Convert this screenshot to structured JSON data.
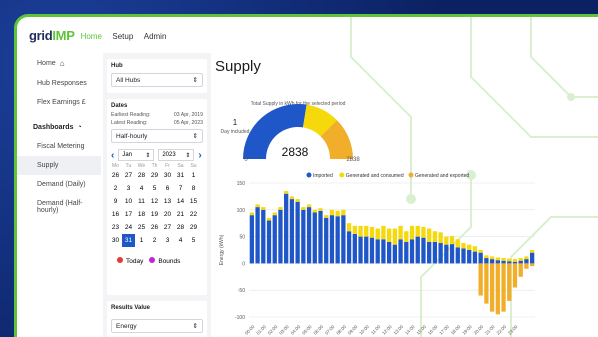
{
  "app": {
    "logo_prefix": "grid",
    "logo_suffix": "IMP",
    "nav": [
      "Home",
      "Setup",
      "Admin"
    ]
  },
  "sidebar": {
    "items": [
      {
        "label": "Home",
        "icon": "home-icon"
      },
      {
        "label": "Hub Responses"
      },
      {
        "label": "Flex Earnings £"
      }
    ],
    "section": {
      "label": "Dashboards",
      "icon": "dashboard-icon"
    },
    "sub_items": [
      "Fiscal Metering",
      "Supply",
      "Demand (Daily)",
      "Demand (Half-hourly)"
    ]
  },
  "filters": {
    "hub_label": "Hub",
    "hub_value": "All Hubs",
    "dates_label": "Dates",
    "earliest_label": "Earliest Reading:",
    "earliest_value": "03 Apr, 2019",
    "latest_label": "Latest Reading:",
    "latest_value": "05 Apr, 2023",
    "interval_value": "Half-hourly",
    "results_label": "Results Value",
    "results_value": "Energy"
  },
  "calendar": {
    "month": "Jan",
    "year": "2023",
    "dow": [
      "Mo",
      "Tu",
      "We",
      "Th",
      "Fr",
      "Sa",
      "Su"
    ],
    "weeks": [
      [
        "26",
        "27",
        "28",
        "29",
        "30",
        "31",
        "1"
      ],
      [
        "2",
        "3",
        "4",
        "5",
        "6",
        "7",
        "8"
      ],
      [
        "9",
        "10",
        "11",
        "12",
        "13",
        "14",
        "15"
      ],
      [
        "16",
        "17",
        "18",
        "19",
        "20",
        "21",
        "22"
      ],
      [
        "23",
        "24",
        "25",
        "26",
        "27",
        "28",
        "29"
      ],
      [
        "30",
        "31",
        "1",
        "2",
        "3",
        "4",
        "5"
      ]
    ],
    "today_label": "Today",
    "bounds_label": "Bounds",
    "today_color": "#e53935",
    "bounds_color": "#c026d3"
  },
  "main": {
    "title": "Supply",
    "gauge_caption": "Total Supply in kWh for the selected period",
    "days_value": "1",
    "days_label": "Day included",
    "gauge_min": "0",
    "gauge_value": "2838",
    "gauge_max": "2838",
    "segments": [
      {
        "name": "Imported",
        "value": 0.55,
        "color": "#1f57c8"
      },
      {
        "name": "Generated and consumed",
        "value": 0.2,
        "color": "#f5d90a"
      },
      {
        "name": "Generated and exported",
        "value": 0.25,
        "color": "#f0ae2a"
      }
    ]
  },
  "chart_data": {
    "type": "bar",
    "ylabel": "Energy (kWh)",
    "ylim": [
      -100,
      150
    ],
    "yticks": [
      150,
      100,
      50,
      0,
      -50,
      -100
    ],
    "xticks": [
      "00:00",
      "01:00",
      "02:00",
      "03:00",
      "04:00",
      "05:00",
      "06:00",
      "07:00",
      "08:00",
      "09:00",
      "10:00",
      "11:00",
      "12:00",
      "13:00",
      "14:00",
      "15:00",
      "16:00",
      "17:00",
      "18:00",
      "19:00",
      "20:00",
      "21:00",
      "22:00",
      "23:00"
    ],
    "legend": [
      "Imported",
      "Generated and consumed",
      "Generated and exported"
    ],
    "series": [
      {
        "name": "Imported",
        "color": "#1f57c8",
        "values": [
          90,
          105,
          100,
          80,
          90,
          100,
          130,
          120,
          115,
          100,
          105,
          95,
          98,
          85,
          90,
          88,
          90,
          60,
          55,
          50,
          50,
          48,
          45,
          45,
          40,
          35,
          45,
          40,
          45,
          50,
          48,
          40,
          40,
          38,
          35,
          36,
          30,
          28,
          25,
          22,
          20,
          10,
          8,
          6,
          5,
          4,
          3,
          5,
          8,
          20
        ]
      },
      {
        "name": "Generated and consumed",
        "color": "#f5d90a",
        "values": [
          5,
          5,
          5,
          5,
          5,
          5,
          5,
          5,
          5,
          5,
          5,
          5,
          5,
          5,
          10,
          10,
          10,
          15,
          15,
          20,
          20,
          20,
          20,
          25,
          25,
          30,
          25,
          20,
          25,
          20,
          20,
          25,
          20,
          20,
          15,
          15,
          15,
          10,
          10,
          10,
          5,
          5,
          5,
          5,
          5,
          5,
          5,
          5,
          5,
          5
        ]
      },
      {
        "name": "Generated and exported",
        "color": "#f0ae2a",
        "values": [
          0,
          0,
          0,
          0,
          0,
          0,
          0,
          0,
          0,
          0,
          0,
          0,
          0,
          0,
          0,
          0,
          0,
          0,
          0,
          0,
          0,
          0,
          0,
          0,
          0,
          0,
          0,
          0,
          0,
          0,
          0,
          0,
          0,
          0,
          0,
          0,
          0,
          0,
          0,
          0,
          -60,
          -75,
          -90,
          -95,
          -90,
          -70,
          -45,
          -25,
          -10,
          -5
        ]
      }
    ]
  }
}
